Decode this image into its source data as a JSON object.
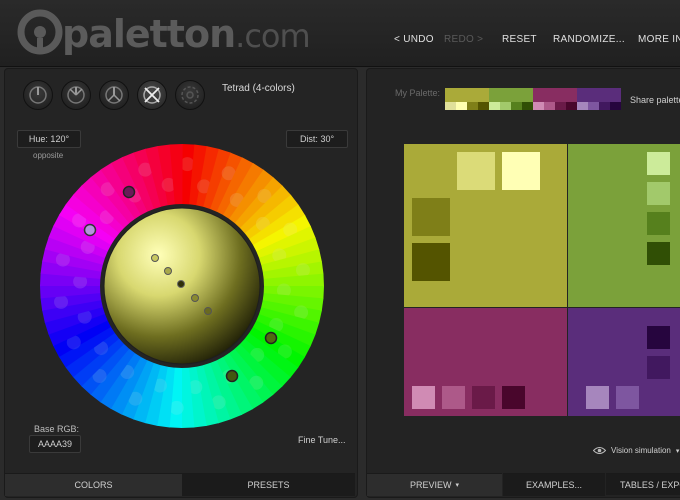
{
  "header": {
    "logo_text": "paletton",
    "logo_tld": ".com",
    "nav": {
      "undo": "< UNDO",
      "redo": "REDO >",
      "reset": "RESET",
      "randomize": "RANDOMIZE...",
      "more_info": "MORE INFO"
    }
  },
  "left_panel": {
    "scheme_buttons": [
      {
        "name": "mono",
        "icon": "mono-scheme-icon"
      },
      {
        "name": "adjacent",
        "icon": "adjacent-scheme-icon"
      },
      {
        "name": "triad",
        "icon": "triad-scheme-icon"
      },
      {
        "name": "tetrad",
        "icon": "tetrad-scheme-icon",
        "active": true
      },
      {
        "name": "free",
        "icon": "free-style-icon"
      }
    ],
    "scheme_label": "Tetrad (4-colors)",
    "hue_field": "Hue: 120°",
    "hue_sub": "opposite",
    "dist_field": "Dist: 30°",
    "base_rgb_label": "Base RGB:",
    "base_rgb_value": "AAAA39",
    "fine_tune": "Fine Tune...",
    "tabs": {
      "colors": "COLORS",
      "presets": "PRESETS"
    }
  },
  "right_panel": {
    "my_palette_label": "My Palette:",
    "share_label": "Share palette",
    "vision_label": "Vision simulation",
    "tabs": {
      "preview": "PREVIEW",
      "examples": "EXAMPLES...",
      "tables": "TABLES / EXPORT"
    }
  },
  "colors": {
    "accent_yellow": "#AAAA39",
    "green": "#7AA13A",
    "magenta": "#8A2E62",
    "purple": "#5C2C7C"
  },
  "palette_strip": {
    "primary": [
      "#AAAA39",
      "#E0E09A",
      "#FFFFB0",
      "#7F7F18",
      "#545400"
    ],
    "secondary": [
      "#7BA13A",
      "#CCEB9A",
      "#A2C96B",
      "#56801D",
      "#304F05"
    ],
    "tertiary": [
      "#882D61",
      "#D08BB4",
      "#AD5989",
      "#6A1A48",
      "#49062C"
    ],
    "quaternary": [
      "#5A2D7B",
      "#A686BD",
      "#7E56A0",
      "#41185F",
      "#26053E"
    ]
  }
}
